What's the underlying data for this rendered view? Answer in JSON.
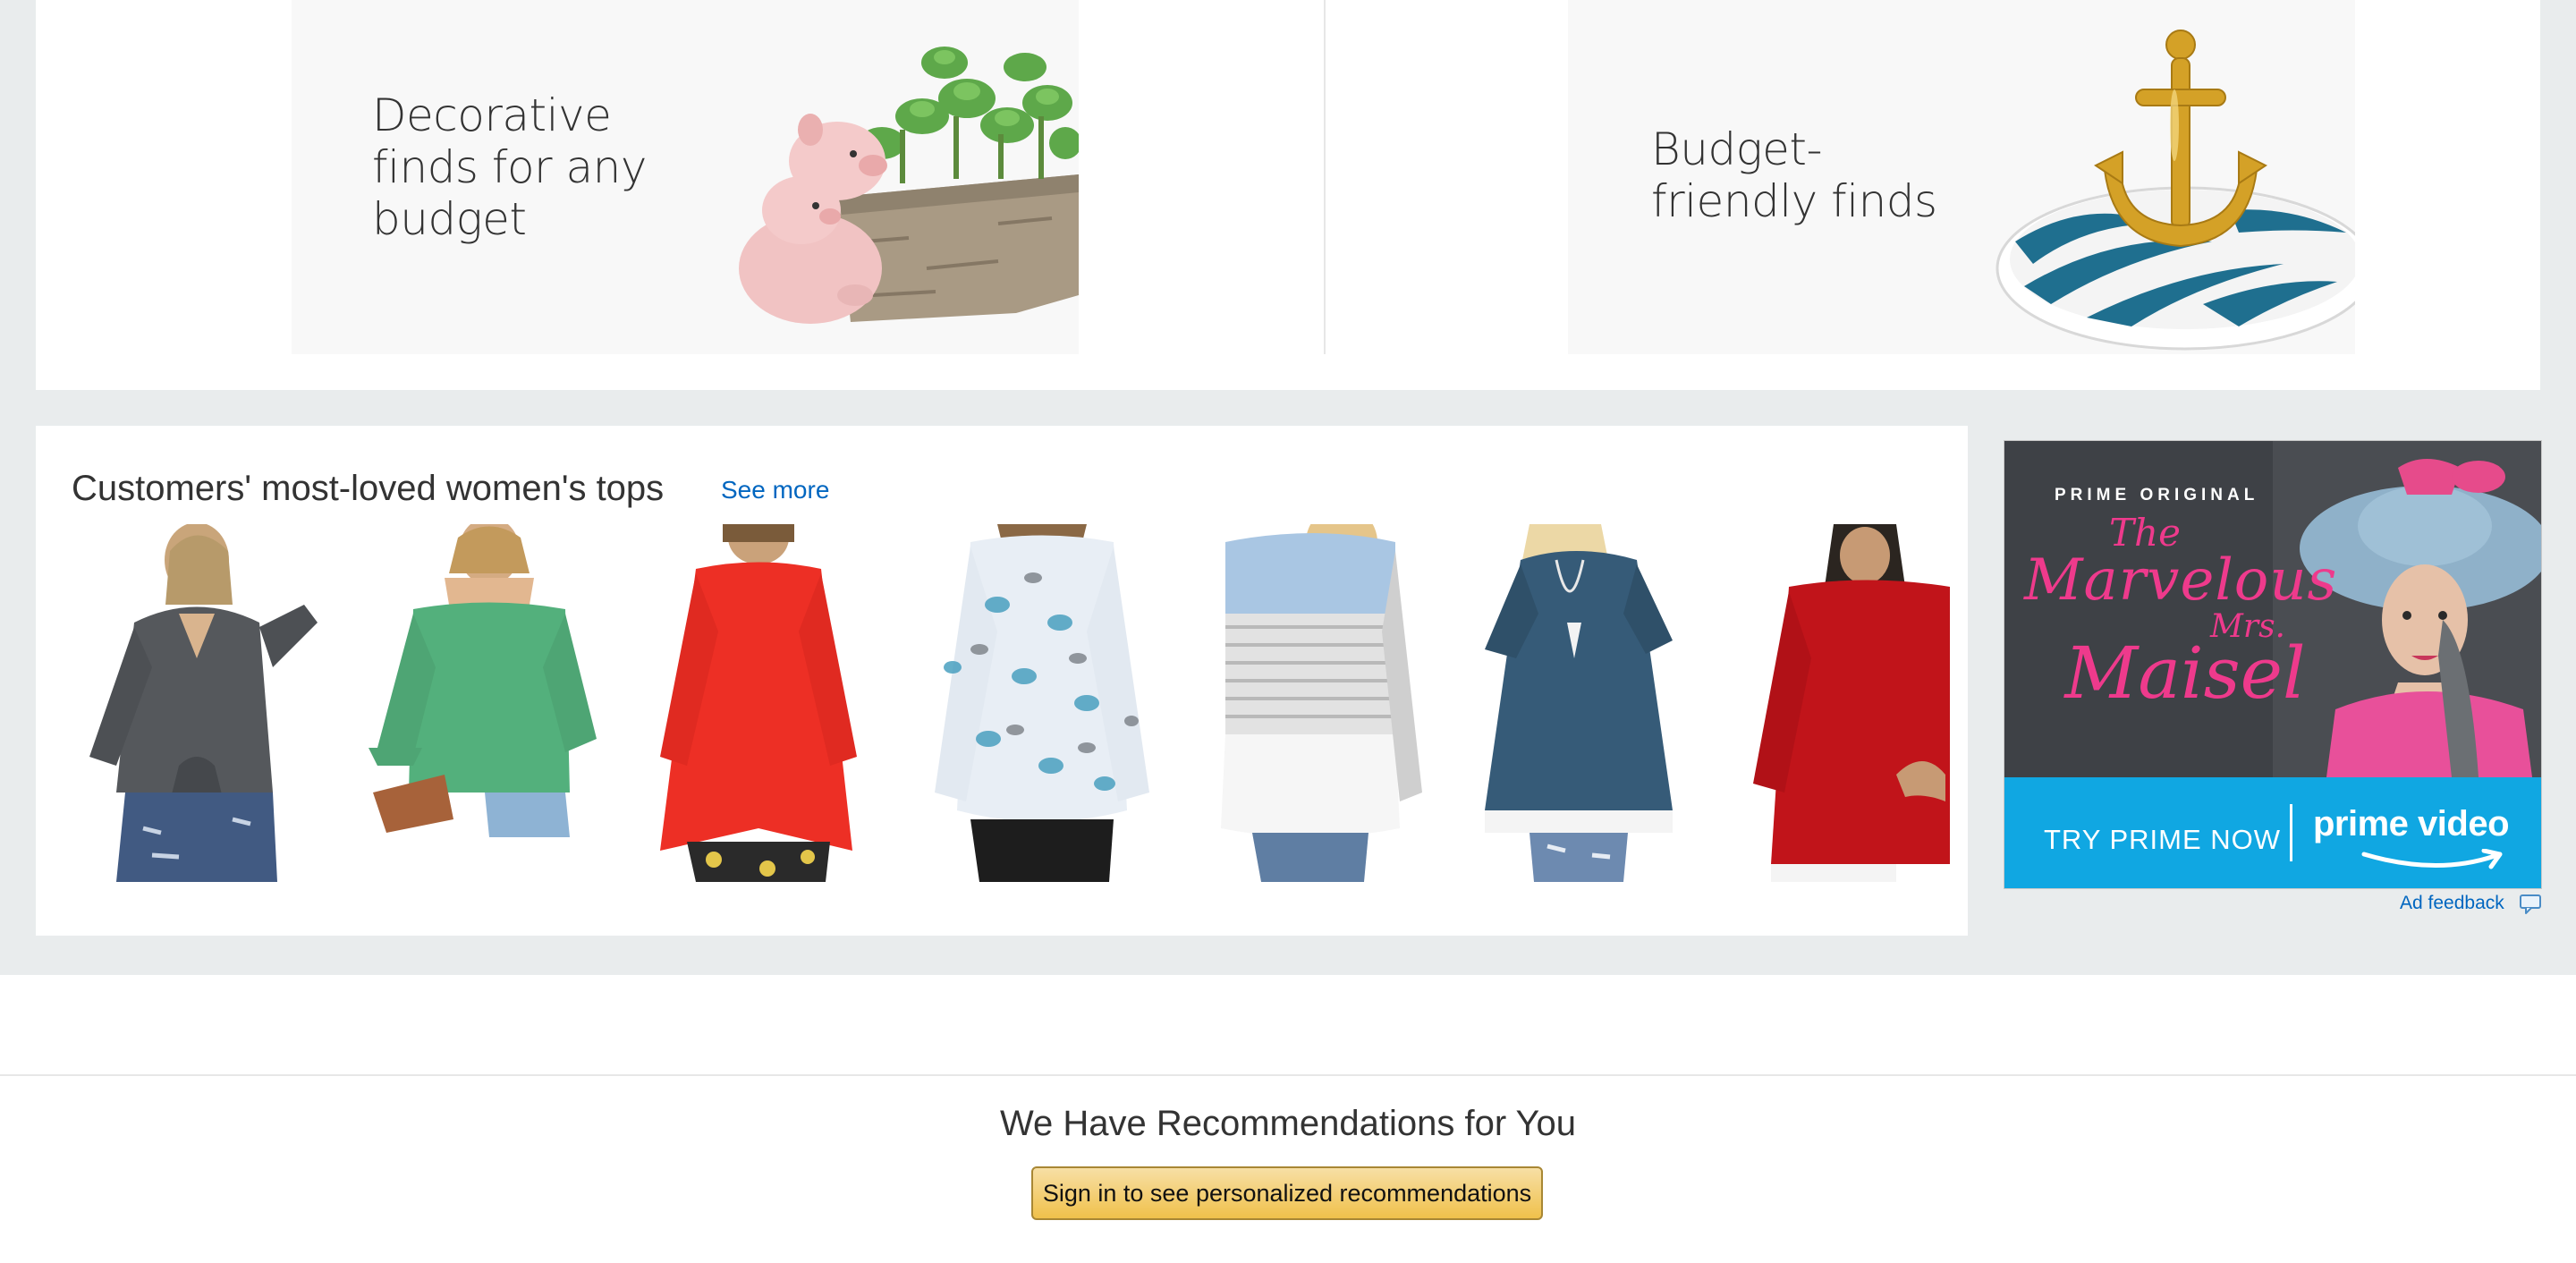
{
  "promos": {
    "left": {
      "text": "Decorative finds for any budget",
      "image": "pig-planter-image"
    },
    "right": {
      "text": "Budget-friendly finds",
      "image": "anchor-ring-dish-image"
    }
  },
  "tops": {
    "title": "Customers' most-loved women's tops",
    "see_more": "See more",
    "products": [
      {
        "image": "grey-tie-front-knit-top"
      },
      {
        "image": "green-off-shoulder-top"
      },
      {
        "image": "red-swing-tunic-top"
      },
      {
        "image": "paisley-print-blouse"
      },
      {
        "image": "blue-grey-striped-colorblock-top"
      },
      {
        "image": "navy-lace-hem-tunic"
      },
      {
        "image": "red-cold-shoulder-top"
      }
    ]
  },
  "ad": {
    "kicker": "PRIME ORIGINAL",
    "show_line1": "The",
    "show_line2": "Marvelous",
    "show_line3": "Mrs.",
    "show_line4": "Maisel",
    "cta": "TRY PRIME NOW",
    "brand": "prime video",
    "feedback": "Ad feedback"
  },
  "recommendations": {
    "title": "We Have Recommendations for You",
    "button": "Sign in to see personalized recommendations"
  },
  "colors": {
    "page_band": "#e9eced",
    "link": "#0066c0",
    "button_gold": "#f0c14b",
    "prime_blue": "#10a7e2",
    "ad_pink": "#ee3a8c"
  }
}
